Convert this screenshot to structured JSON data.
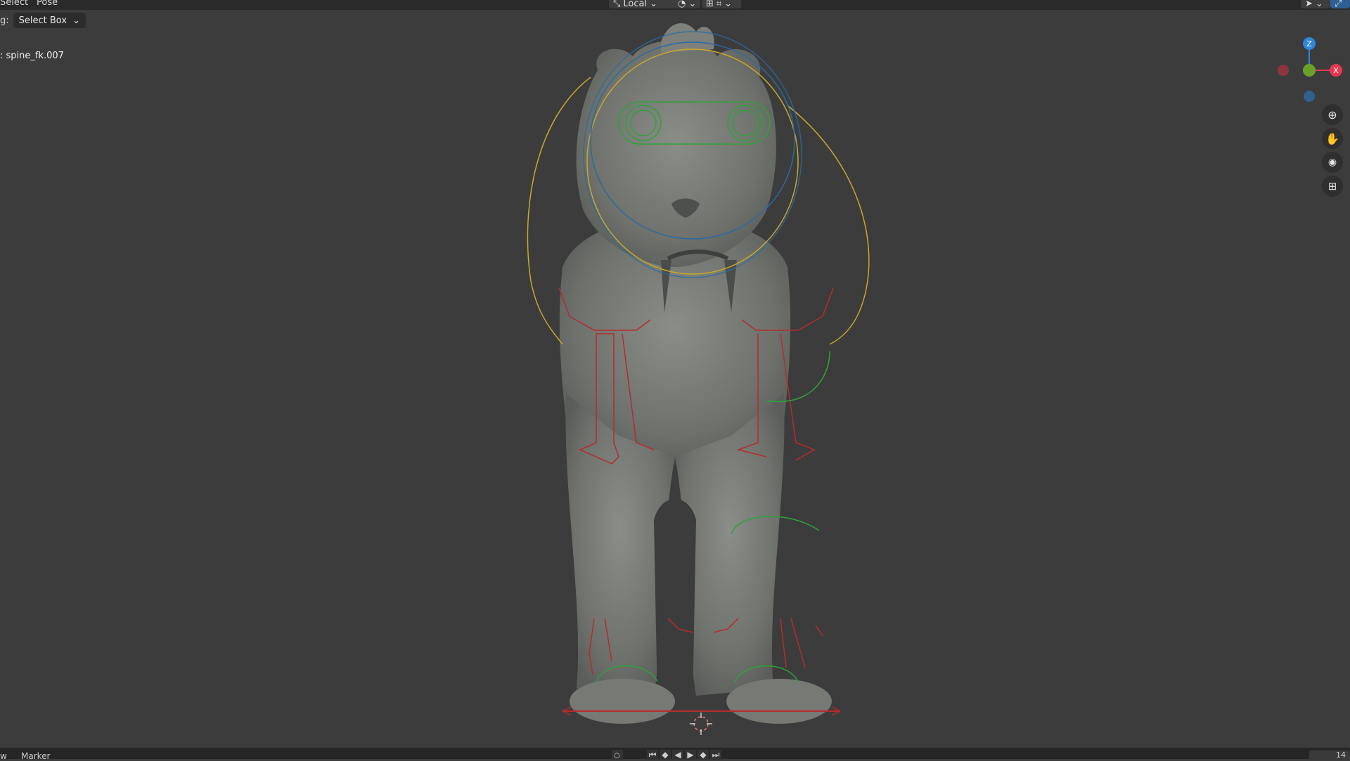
{
  "header": {
    "menus": [
      {
        "label": "Select"
      },
      {
        "label": "Pose"
      }
    ],
    "orientation": {
      "label": "Local"
    }
  },
  "tool_settings": {
    "drag_label": "g:",
    "drag_value": "Select Box"
  },
  "viewport": {
    "active_bone": ": spine_fk.007",
    "gizmo": {
      "z_label": "Z",
      "x_label": "X"
    },
    "colors": {
      "background": "#3c3c3c",
      "bone_yellow": "#c8a82a",
      "bone_green": "#2fa33a",
      "bone_red": "#b52c2c",
      "bone_blue": "#2a6aa3",
      "axis_x": "#e8384f",
      "axis_y": "#6ba02a",
      "axis_z": "#2d86d9"
    },
    "nav_icons": [
      "zoom-icon",
      "hand-pan-icon",
      "camera-icon",
      "grid-icon"
    ]
  },
  "timeline": {
    "menus": [
      {
        "label": "w"
      },
      {
        "label": "Marker"
      }
    ],
    "current_frame": "14"
  }
}
